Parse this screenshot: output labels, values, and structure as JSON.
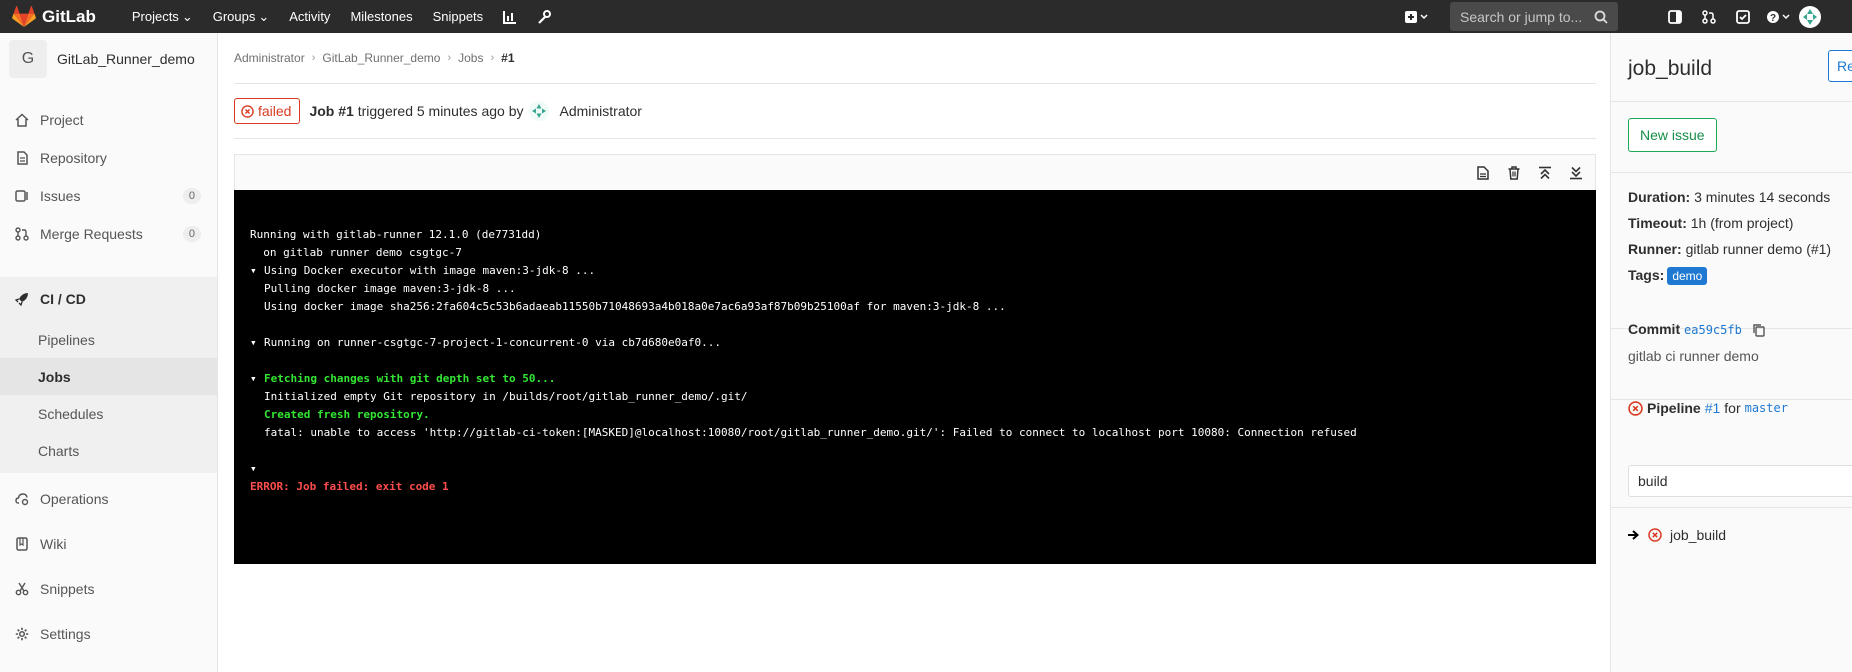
{
  "topbar": {
    "logo": "GitLab",
    "nav": [
      "Projects",
      "Groups",
      "Activity",
      "Milestones",
      "Snippets"
    ],
    "search_placeholder": "Search or jump to..."
  },
  "sidebar": {
    "project_initial": "G",
    "project_name": "GitLab_Runner_demo",
    "items": [
      {
        "label": "Project",
        "icon": "home-icon"
      },
      {
        "label": "Repository",
        "icon": "doc-icon"
      },
      {
        "label": "Issues",
        "icon": "issues-icon",
        "count": "0"
      },
      {
        "label": "Merge Requests",
        "icon": "merge-icon",
        "count": "0"
      },
      {
        "label": "CI / CD",
        "icon": "rocket-icon"
      },
      {
        "label": "Operations",
        "icon": "cloud-gear-icon"
      },
      {
        "label": "Wiki",
        "icon": "book-icon"
      },
      {
        "label": "Snippets",
        "icon": "scissors-icon"
      },
      {
        "label": "Settings",
        "icon": "gear-icon"
      }
    ],
    "cicd_sub": [
      "Pipelines",
      "Jobs",
      "Schedules",
      "Charts"
    ]
  },
  "breadcrumb": [
    "Administrator",
    "GitLab_Runner_demo",
    "Jobs",
    "#1"
  ],
  "job": {
    "status": "failed",
    "id": "Job #1",
    "triggered": "triggered 5 minutes ago by",
    "user": "Administrator"
  },
  "log": [
    {
      "text": "Running with gitlab-runner 12.1.0 (de7731dd)",
      "caret": false,
      "style": "normal"
    },
    {
      "text": "  on gitlab runner demo csgtgc-7",
      "caret": false,
      "style": "normal"
    },
    {
      "text": "Using Docker executor with image maven:3-jdk-8 ...",
      "caret": true,
      "style": "normal"
    },
    {
      "text": "Pulling docker image maven:3-jdk-8 ...",
      "caret": false,
      "indent": true,
      "style": "normal"
    },
    {
      "text": "Using docker image sha256:2fa604c5c53b6adaeab11550b71048693a4b018a0e7ac6a93af87b09b25100af for maven:3-jdk-8 ...",
      "caret": false,
      "indent": true,
      "style": "normal"
    },
    {
      "text": "",
      "caret": false,
      "style": "normal"
    },
    {
      "text": "Running on runner-csgtgc-7-project-1-concurrent-0 via cb7d680e0af0...",
      "caret": true,
      "style": "normal"
    },
    {
      "text": "",
      "caret": false,
      "style": "normal"
    },
    {
      "text": "Fetching changes with git depth set to 50...",
      "caret": true,
      "style": "green"
    },
    {
      "text": "Initialized empty Git repository in /builds/root/gitlab_runner_demo/.git/",
      "caret": false,
      "indent": true,
      "style": "normal"
    },
    {
      "text": "Created fresh repository.",
      "caret": false,
      "indent": true,
      "style": "green"
    },
    {
      "text": "fatal: unable to access 'http://gitlab-ci-token:[MASKED]@localhost:10080/root/gitlab_runner_demo.git/': Failed to connect to localhost port 10080: Connection refused",
      "caret": false,
      "indent": true,
      "style": "normal"
    },
    {
      "text": "",
      "caret": false,
      "style": "normal"
    },
    {
      "text": "",
      "caret": true,
      "style": "normal"
    },
    {
      "text": "ERROR: Job failed: exit code 1",
      "caret": false,
      "style": "red"
    }
  ],
  "right_panel": {
    "title": "job_build",
    "retry_label": "Retry",
    "new_issue": "New issue",
    "duration_label": "Duration:",
    "duration": "3 minutes 14 seconds",
    "timeout_label": "Timeout:",
    "timeout": "1h (from project)",
    "runner_label": "Runner:",
    "runner": "gitlab runner demo (#1)",
    "tags_label": "Tags:",
    "tag": "demo",
    "commit_label": "Commit",
    "commit_sha": "ea59c5fb",
    "commit_msg": "gitlab ci runner demo",
    "pipeline_label": "Pipeline",
    "pipeline_id": "#1",
    "pipeline_for": "for",
    "pipeline_branch": "master",
    "stage": "build",
    "job_name": "job_build"
  },
  "colors": {
    "failed": "#db3b21",
    "link": "#1f78d1",
    "success": "#1aaa55",
    "topbar": "#2b2b2b"
  }
}
